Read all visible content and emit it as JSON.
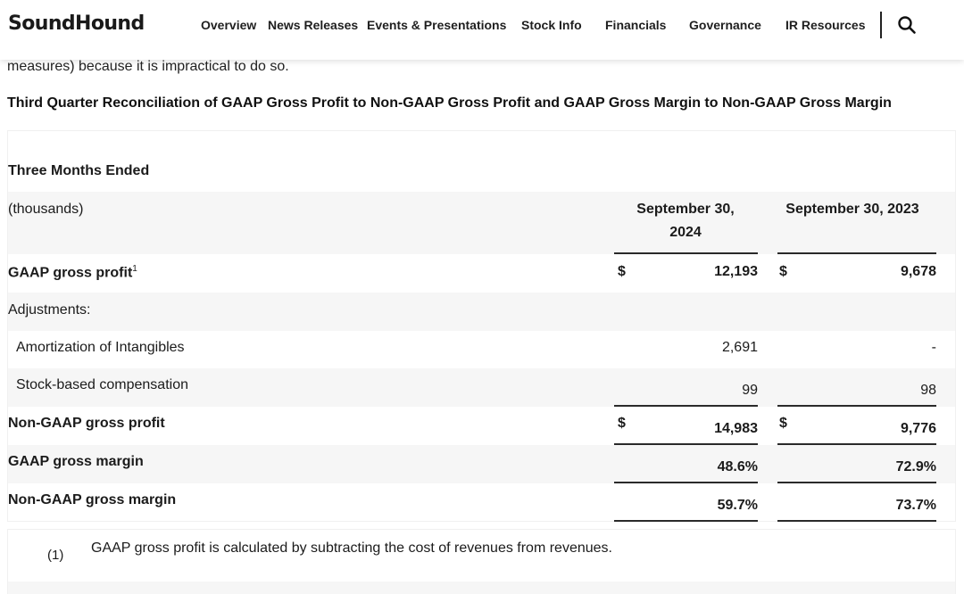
{
  "header": {
    "logo": "SoundHound",
    "nav": [
      {
        "label": "Overview"
      },
      {
        "label": "News Releases"
      },
      {
        "label": "Events & Presentations"
      },
      {
        "label": "Stock Info"
      },
      {
        "label": "Financials"
      },
      {
        "label": "Governance"
      },
      {
        "label": "IR Resources"
      }
    ]
  },
  "content": {
    "cut_text": "measures) because it is impractical to do so.",
    "section_title": "Third Quarter Reconciliation of GAAP Gross Profit to Non-GAAP Gross Profit and GAAP Gross Margin to Non-GAAP Gross Margin"
  },
  "table": {
    "period_label": "Three Months Ended",
    "unit_label": "(thousands)",
    "col1_header_line1": "September 30,",
    "col1_header_line2": "2024",
    "col2_header": "September 30, 2023",
    "rows": [
      {
        "label": "GAAP gross profit",
        "sup": "1",
        "cur1": "$",
        "v1": "12,193",
        "cur2": "$",
        "v2": "9,678"
      },
      {
        "label": "Adjustments:"
      },
      {
        "label": "Amortization of Intangibles",
        "v1": "2,691",
        "v2": "-"
      },
      {
        "label": "Stock-based compensation",
        "v1": "99",
        "v2": "98"
      },
      {
        "label": "Non-GAAP gross profit",
        "cur1": "$",
        "v1": "14,983",
        "cur2": "$",
        "v2": "9,776"
      },
      {
        "label": "GAAP gross margin",
        "v1": "48.6%",
        "v2": "72.9%"
      },
      {
        "label": "Non-GAAP gross margin",
        "v1": "59.7%",
        "v2": "73.7%"
      }
    ]
  },
  "footnote": {
    "marker": "(1)",
    "text": "GAAP gross profit is calculated by subtracting the cost of revenues from revenues."
  }
}
